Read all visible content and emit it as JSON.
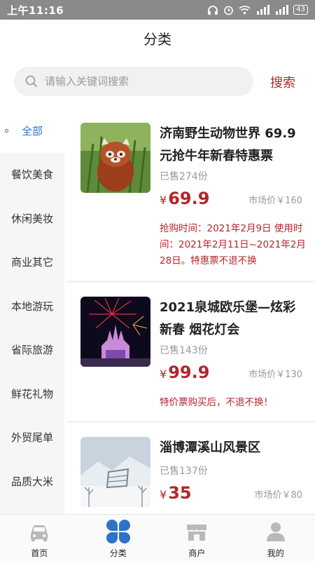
{
  "status": {
    "time": "上午11:16",
    "battery": "43"
  },
  "header": {
    "title": "分类"
  },
  "search": {
    "placeholder": "请输入关键词搜索",
    "button": "搜索"
  },
  "sidebar": {
    "items": [
      {
        "label": "全部",
        "active": true
      },
      {
        "label": "餐饮美食"
      },
      {
        "label": "休闲美妆"
      },
      {
        "label": "商业其它"
      },
      {
        "label": "本地游玩"
      },
      {
        "label": "省际旅游"
      },
      {
        "label": "鲜花礼物"
      },
      {
        "label": "外贸尾单"
      },
      {
        "label": "品质大米"
      }
    ]
  },
  "products": [
    {
      "title": "济南野生动物世界 69.9元抢牛年新春特惠票",
      "sold": "已售274份",
      "currency": "¥",
      "price": "69.9",
      "market": "市场价￥160",
      "note": "抢购时间：2021年2月9日 使用时间：2021年2月11日~2021年2月28日。特惠票不退不换",
      "image": "red-panda"
    },
    {
      "title": "2021泉城欧乐堡—炫彩新春 烟花灯会",
      "sold": "已售143份",
      "currency": "¥",
      "price": "99.9",
      "market": "市场价￥130",
      "note": "特价票购买后，不退不换！",
      "image": "fireworks-castle"
    },
    {
      "title": "淄博潭溪山风景区",
      "sold": "已售137份",
      "currency": "¥",
      "price": "35",
      "market": "市场价￥80",
      "image": "snowy-mountain"
    }
  ],
  "nav": {
    "items": [
      {
        "label": "首页",
        "icon": "car-icon"
      },
      {
        "label": "分类",
        "icon": "clover-icon",
        "active": true
      },
      {
        "label": "商户",
        "icon": "shop-icon"
      },
      {
        "label": "我的",
        "icon": "person-icon"
      }
    ]
  },
  "colors": {
    "accent_red": "#b3262b",
    "active_blue": "#2f73c6",
    "status_bar": "#8a8a8a"
  }
}
